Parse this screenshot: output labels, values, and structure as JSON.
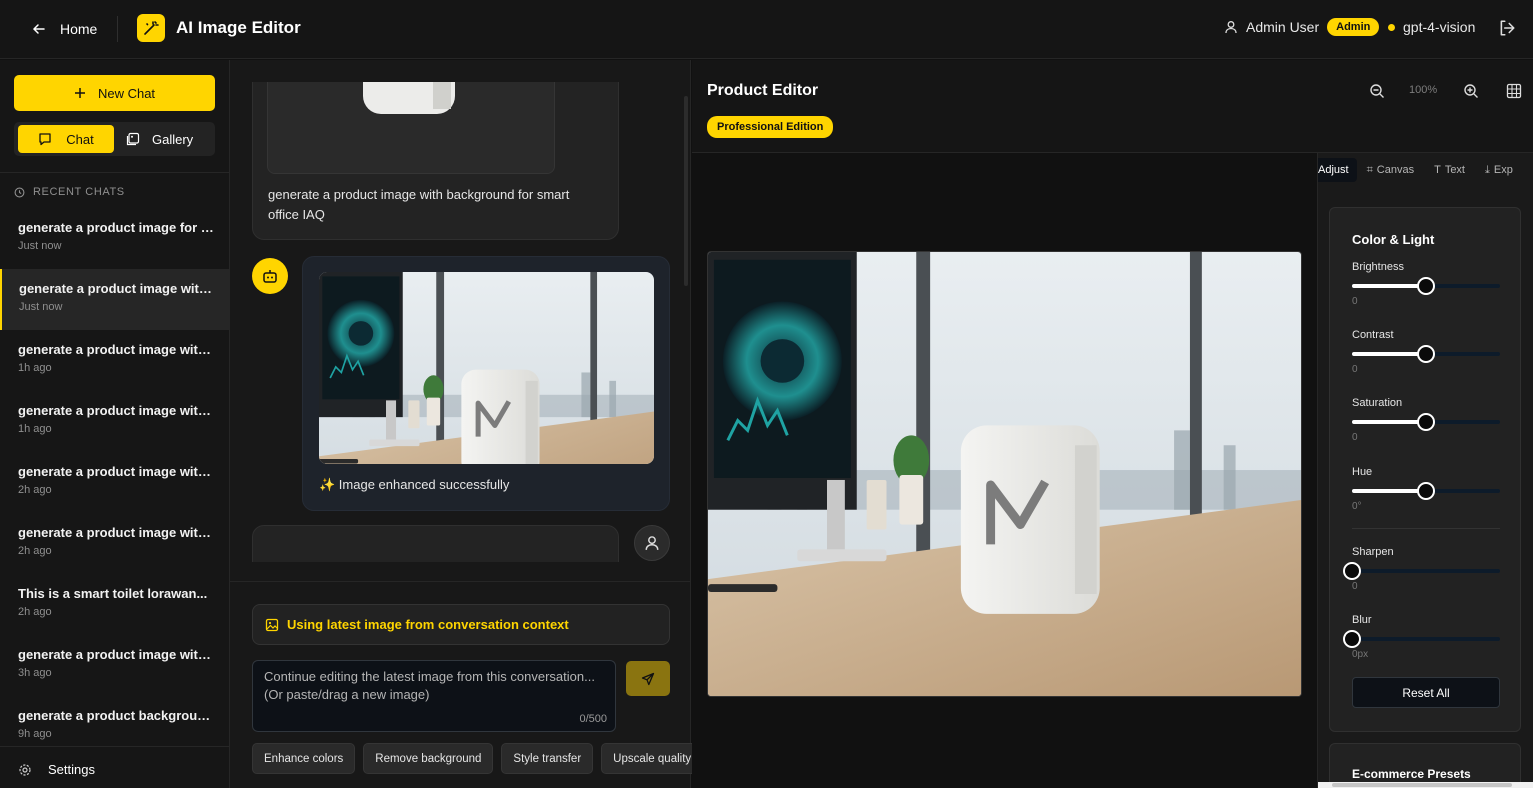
{
  "topbar": {
    "home_label": "Home",
    "app_title": "AI Image Editor",
    "user_name": "Admin User",
    "role_badge": "Admin",
    "model": "gpt-4-vision",
    "accent_color": "#FFD500"
  },
  "sidebar": {
    "new_chat_label": "New Chat",
    "tab_chat": "Chat",
    "tab_gallery": "Gallery",
    "recent_header": "RECENT CHATS",
    "chats": [
      {
        "title": "generate a product image for L...",
        "time": "Just now"
      },
      {
        "title": "generate a product image with ...",
        "time": "Just now"
      },
      {
        "title": "generate a product image with ...",
        "time": "1h ago"
      },
      {
        "title": "generate a product image with ...",
        "time": "1h ago"
      },
      {
        "title": "generate a product image with ...",
        "time": "2h ago"
      },
      {
        "title": "generate a product image with ...",
        "time": "2h ago"
      },
      {
        "title": "This is a smart toilet lorawan...",
        "time": "2h ago"
      },
      {
        "title": "generate a product image with ...",
        "time": "3h ago"
      },
      {
        "title": "generate a product background ...",
        "time": "9h ago"
      }
    ],
    "settings_label": "Settings"
  },
  "chat": {
    "user_message_1": "generate a product image with background for smart office IAQ",
    "bot_message": "✨ Image enhanced successfully",
    "context_banner": "Using latest image from conversation context",
    "input_placeholder": "Continue editing the latest image from this conversation... (Or paste/drag a new image)",
    "char_count": "0/500",
    "quick_actions": [
      "Enhance colors",
      "Remove background",
      "Style transfer",
      "Upscale quality"
    ]
  },
  "editor": {
    "title": "Product Editor",
    "edition_badge": "Professional Edition",
    "zoom": "100%",
    "tabs": [
      "Adjust",
      "Canvas",
      "Text",
      "Exp"
    ],
    "section_title": "Color & Light",
    "sliders": {
      "brightness": {
        "label": "Brightness",
        "value": "0",
        "level": 0.5
      },
      "contrast": {
        "label": "Contrast",
        "value": "0",
        "level": 0.5
      },
      "saturation": {
        "label": "Saturation",
        "value": "0",
        "level": 0.5
      },
      "hue": {
        "label": "Hue",
        "value": "0°",
        "level": 0.5
      },
      "sharpen": {
        "label": "Sharpen",
        "value": "0",
        "level": 0
      },
      "blur": {
        "label": "Blur",
        "value": "0px",
        "level": 0
      }
    },
    "reset_label": "Reset All",
    "presets_title": "E-commerce Presets"
  }
}
